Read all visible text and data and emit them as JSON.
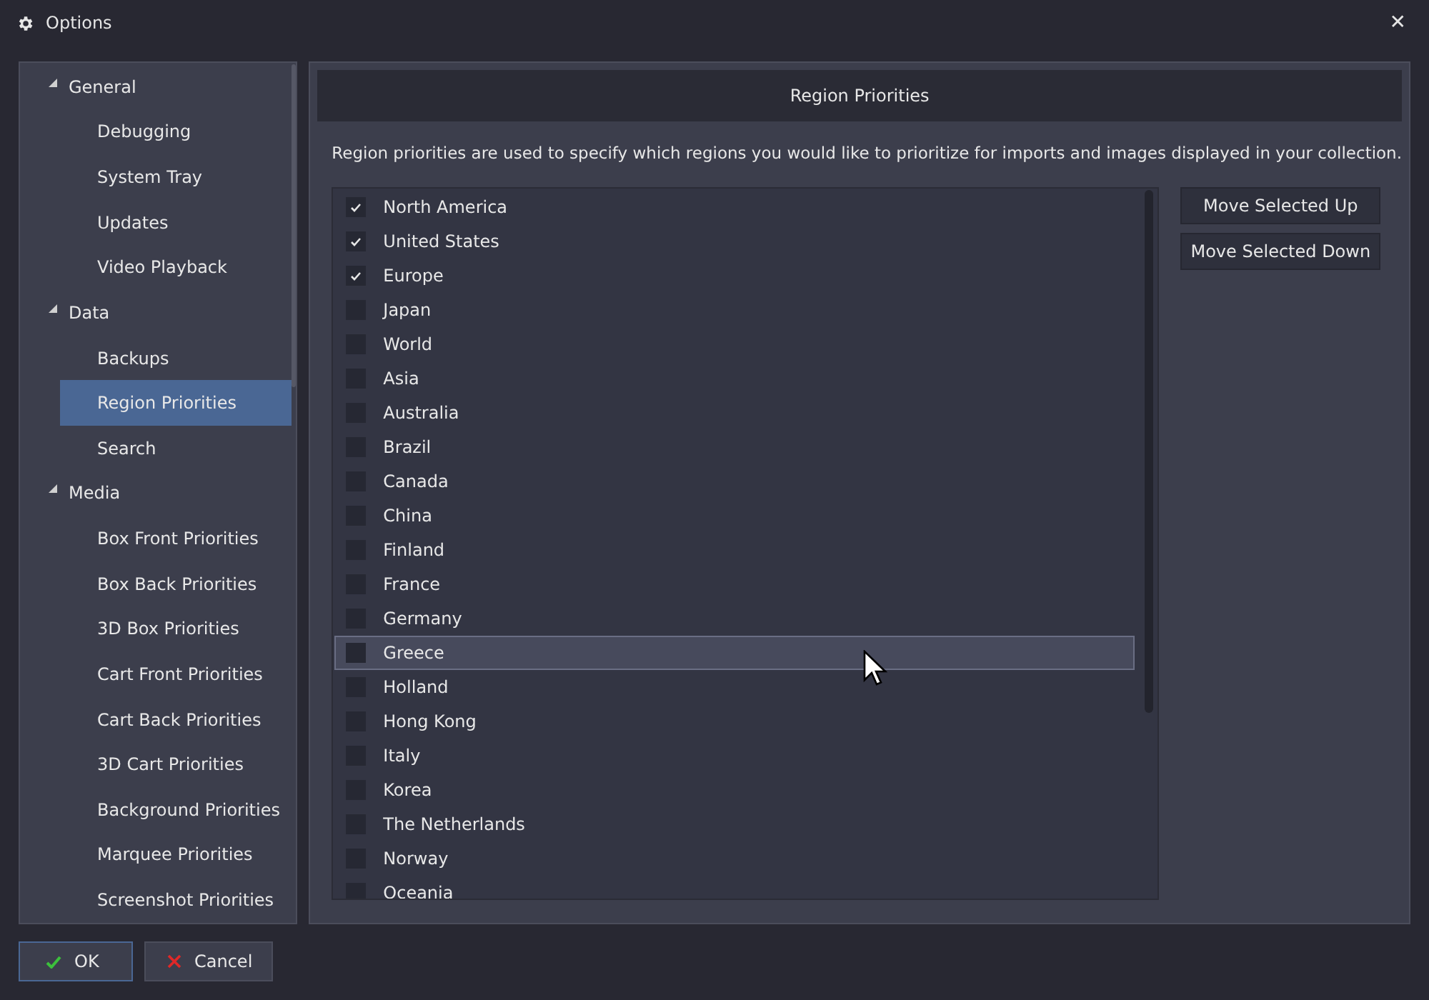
{
  "window": {
    "title": "Options",
    "close": "✕"
  },
  "sidebar": {
    "items": [
      {
        "label": "General",
        "expanded": true,
        "selected": false,
        "children": [
          {
            "label": "Debugging",
            "selected": false
          },
          {
            "label": "System Tray",
            "selected": false
          },
          {
            "label": "Updates",
            "selected": false
          },
          {
            "label": "Video Playback",
            "selected": false
          }
        ]
      },
      {
        "label": "Data",
        "expanded": true,
        "selected": false,
        "children": [
          {
            "label": "Backups",
            "selected": false
          },
          {
            "label": "Region Priorities",
            "selected": true
          },
          {
            "label": "Search",
            "selected": false
          }
        ]
      },
      {
        "label": "Media",
        "expanded": true,
        "selected": false,
        "children": [
          {
            "label": "Box Front Priorities",
            "selected": false
          },
          {
            "label": "Box Back Priorities",
            "selected": false
          },
          {
            "label": "3D Box Priorities",
            "selected": false
          },
          {
            "label": "Cart Front Priorities",
            "selected": false
          },
          {
            "label": "Cart Back Priorities",
            "selected": false
          },
          {
            "label": "3D Cart Priorities",
            "selected": false
          },
          {
            "label": "Background Priorities",
            "selected": false
          },
          {
            "label": "Marquee Priorities",
            "selected": false
          },
          {
            "label": "Screenshot Priorities",
            "selected": false
          }
        ]
      }
    ]
  },
  "panel": {
    "title": "Region Priorities",
    "description": "Region priorities are used to specify which regions you would like to prioritize for imports and images displayed in your collection.",
    "regions": [
      {
        "name": "North America",
        "checked": true,
        "selected": false
      },
      {
        "name": "United States",
        "checked": true,
        "selected": false
      },
      {
        "name": "Europe",
        "checked": true,
        "selected": false
      },
      {
        "name": "Japan",
        "checked": false,
        "selected": false
      },
      {
        "name": "World",
        "checked": false,
        "selected": false
      },
      {
        "name": "Asia",
        "checked": false,
        "selected": false
      },
      {
        "name": "Australia",
        "checked": false,
        "selected": false
      },
      {
        "name": "Brazil",
        "checked": false,
        "selected": false
      },
      {
        "name": "Canada",
        "checked": false,
        "selected": false
      },
      {
        "name": "China",
        "checked": false,
        "selected": false
      },
      {
        "name": "Finland",
        "checked": false,
        "selected": false
      },
      {
        "name": "France",
        "checked": false,
        "selected": false
      },
      {
        "name": "Germany",
        "checked": false,
        "selected": false
      },
      {
        "name": "Greece",
        "checked": false,
        "selected": true
      },
      {
        "name": "Holland",
        "checked": false,
        "selected": false
      },
      {
        "name": "Hong Kong",
        "checked": false,
        "selected": false
      },
      {
        "name": "Italy",
        "checked": false,
        "selected": false
      },
      {
        "name": "Korea",
        "checked": false,
        "selected": false
      },
      {
        "name": "The Netherlands",
        "checked": false,
        "selected": false
      },
      {
        "name": "Norway",
        "checked": false,
        "selected": false
      },
      {
        "name": "Oceania",
        "checked": false,
        "selected": false
      }
    ],
    "buttons": [
      "Move Selected Up",
      "Move Selected Down"
    ]
  },
  "footer": {
    "buttons": [
      {
        "label": "OK",
        "kind": "ok"
      },
      {
        "label": "Cancel",
        "kind": "cancel"
      }
    ]
  }
}
